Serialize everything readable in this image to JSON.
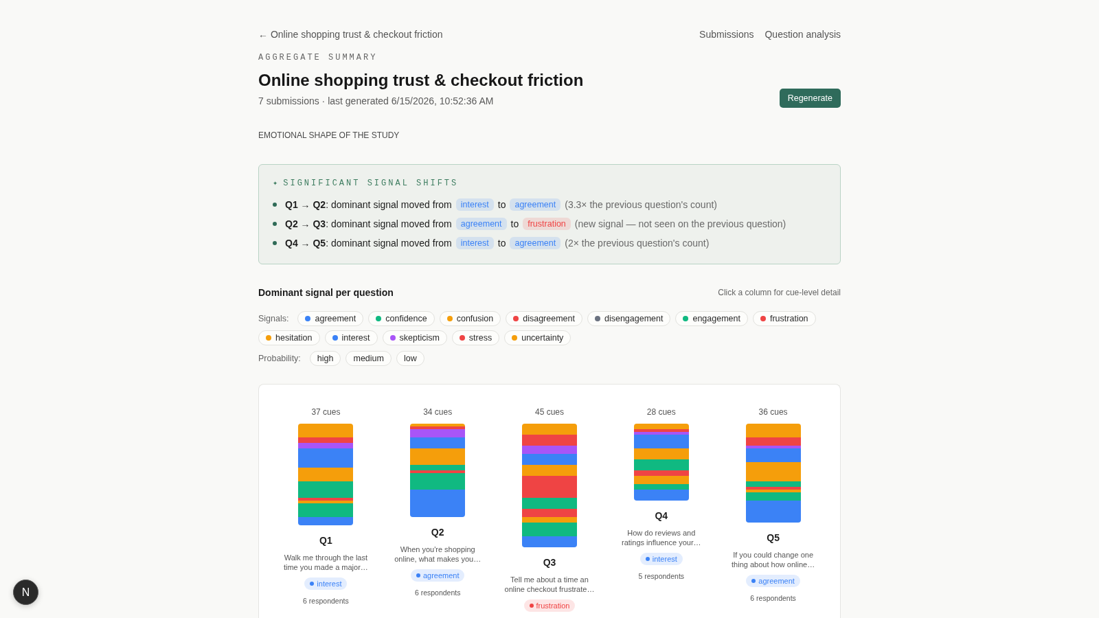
{
  "header": {
    "back_link": "← Online shopping trust & checkout friction",
    "nav": [
      "Submissions",
      "Question analysis"
    ],
    "eyebrow": "AGGREGATE SUMMARY",
    "title": "Online shopping trust & checkout friction",
    "subtitle": "7 submissions · last generated 6/15/2026, 10:52:36 AM",
    "button": "Regenerate"
  },
  "section_label": "EMOTIONAL SHAPE OF THE STUDY",
  "signal_shifts": {
    "icon": "✦",
    "title": "SIGNIFICANT SIGNAL SHIFTS",
    "items": [
      {
        "lead": "**Q1 → Q2**: dominant signal moved from",
        "from": {
          "label": "interest",
          "color": "#3b82f6"
        },
        "joiner": "to",
        "to": {
          "label": "agreement",
          "color": "#3b82f6"
        },
        "note": "(3.3× the previous question's count)"
      },
      {
        "lead": "**Q2 → Q3**: dominant signal moved from",
        "from": {
          "label": "agreement",
          "color": "#3b82f6"
        },
        "joiner": "to",
        "to": {
          "label": "frustration",
          "color": "#ef4444"
        },
        "note": "(new signal — not seen on the previous question)"
      },
      {
        "lead": "**Q4 → Q5**: dominant signal moved from",
        "from": {
          "label": "interest",
          "color": "#3b82f6"
        },
        "joiner": "to",
        "to": {
          "label": "agreement",
          "color": "#3b82f6"
        },
        "note": "(2× the previous question's count)"
      }
    ]
  },
  "dominant_panel": {
    "title": "Dominant signal per question",
    "hint": "Click a column for cue-level detail",
    "signals_label": "Signals:",
    "signals": [
      {
        "label": "agreement",
        "color": "#3b82f6"
      },
      {
        "label": "confidence",
        "color": "#10b981"
      },
      {
        "label": "confusion",
        "color": "#f59e0b"
      },
      {
        "label": "disagreement",
        "color": "#ef4444"
      },
      {
        "label": "disengagement",
        "color": "#6b7280"
      },
      {
        "label": "engagement",
        "color": "#10b981"
      },
      {
        "label": "frustration",
        "color": "#ef4444"
      },
      {
        "label": "hesitation",
        "color": "#f59e0b"
      },
      {
        "label": "interest",
        "color": "#3b82f6"
      },
      {
        "label": "skepticism",
        "color": "#a855f7"
      },
      {
        "label": "stress",
        "color": "#ef4444"
      },
      {
        "label": "uncertainty",
        "color": "#f59e0b"
      }
    ],
    "probability_label": "Probability:",
    "probabilities": [
      "high",
      "medium",
      "low"
    ],
    "columns": [
      {
        "cues": "37 cues",
        "label": "Q1",
        "question": "Walk me through the last time you made a major…",
        "dominant": {
          "label": "interest",
          "color": "#3b82f6"
        },
        "respondents": "6 respondents"
      },
      {
        "cues": "34 cues",
        "label": "Q2",
        "question": "When you're shopping online, what makes you…",
        "dominant": {
          "label": "agreement",
          "color": "#3b82f6"
        },
        "respondents": "6 respondents"
      },
      {
        "cues": "45 cues",
        "label": "Q3",
        "question": "Tell me about a time an online checkout frustrate…",
        "dominant": {
          "label": "frustration",
          "color": "#ef4444"
        }
      },
      {
        "cues": "28 cues",
        "label": "Q4",
        "question": "How do reviews and ratings influence your…",
        "dominant": {
          "label": "interest",
          "color": "#3b82f6"
        },
        "respondents": "5 respondents"
      },
      {
        "cues": "36 cues",
        "label": "Q5",
        "question": "If you could change one thing about how online…",
        "dominant": {
          "label": "agreement",
          "color": "#3b82f6"
        },
        "respondents": "6 respondents"
      }
    ]
  },
  "dev_badge": "N"
}
